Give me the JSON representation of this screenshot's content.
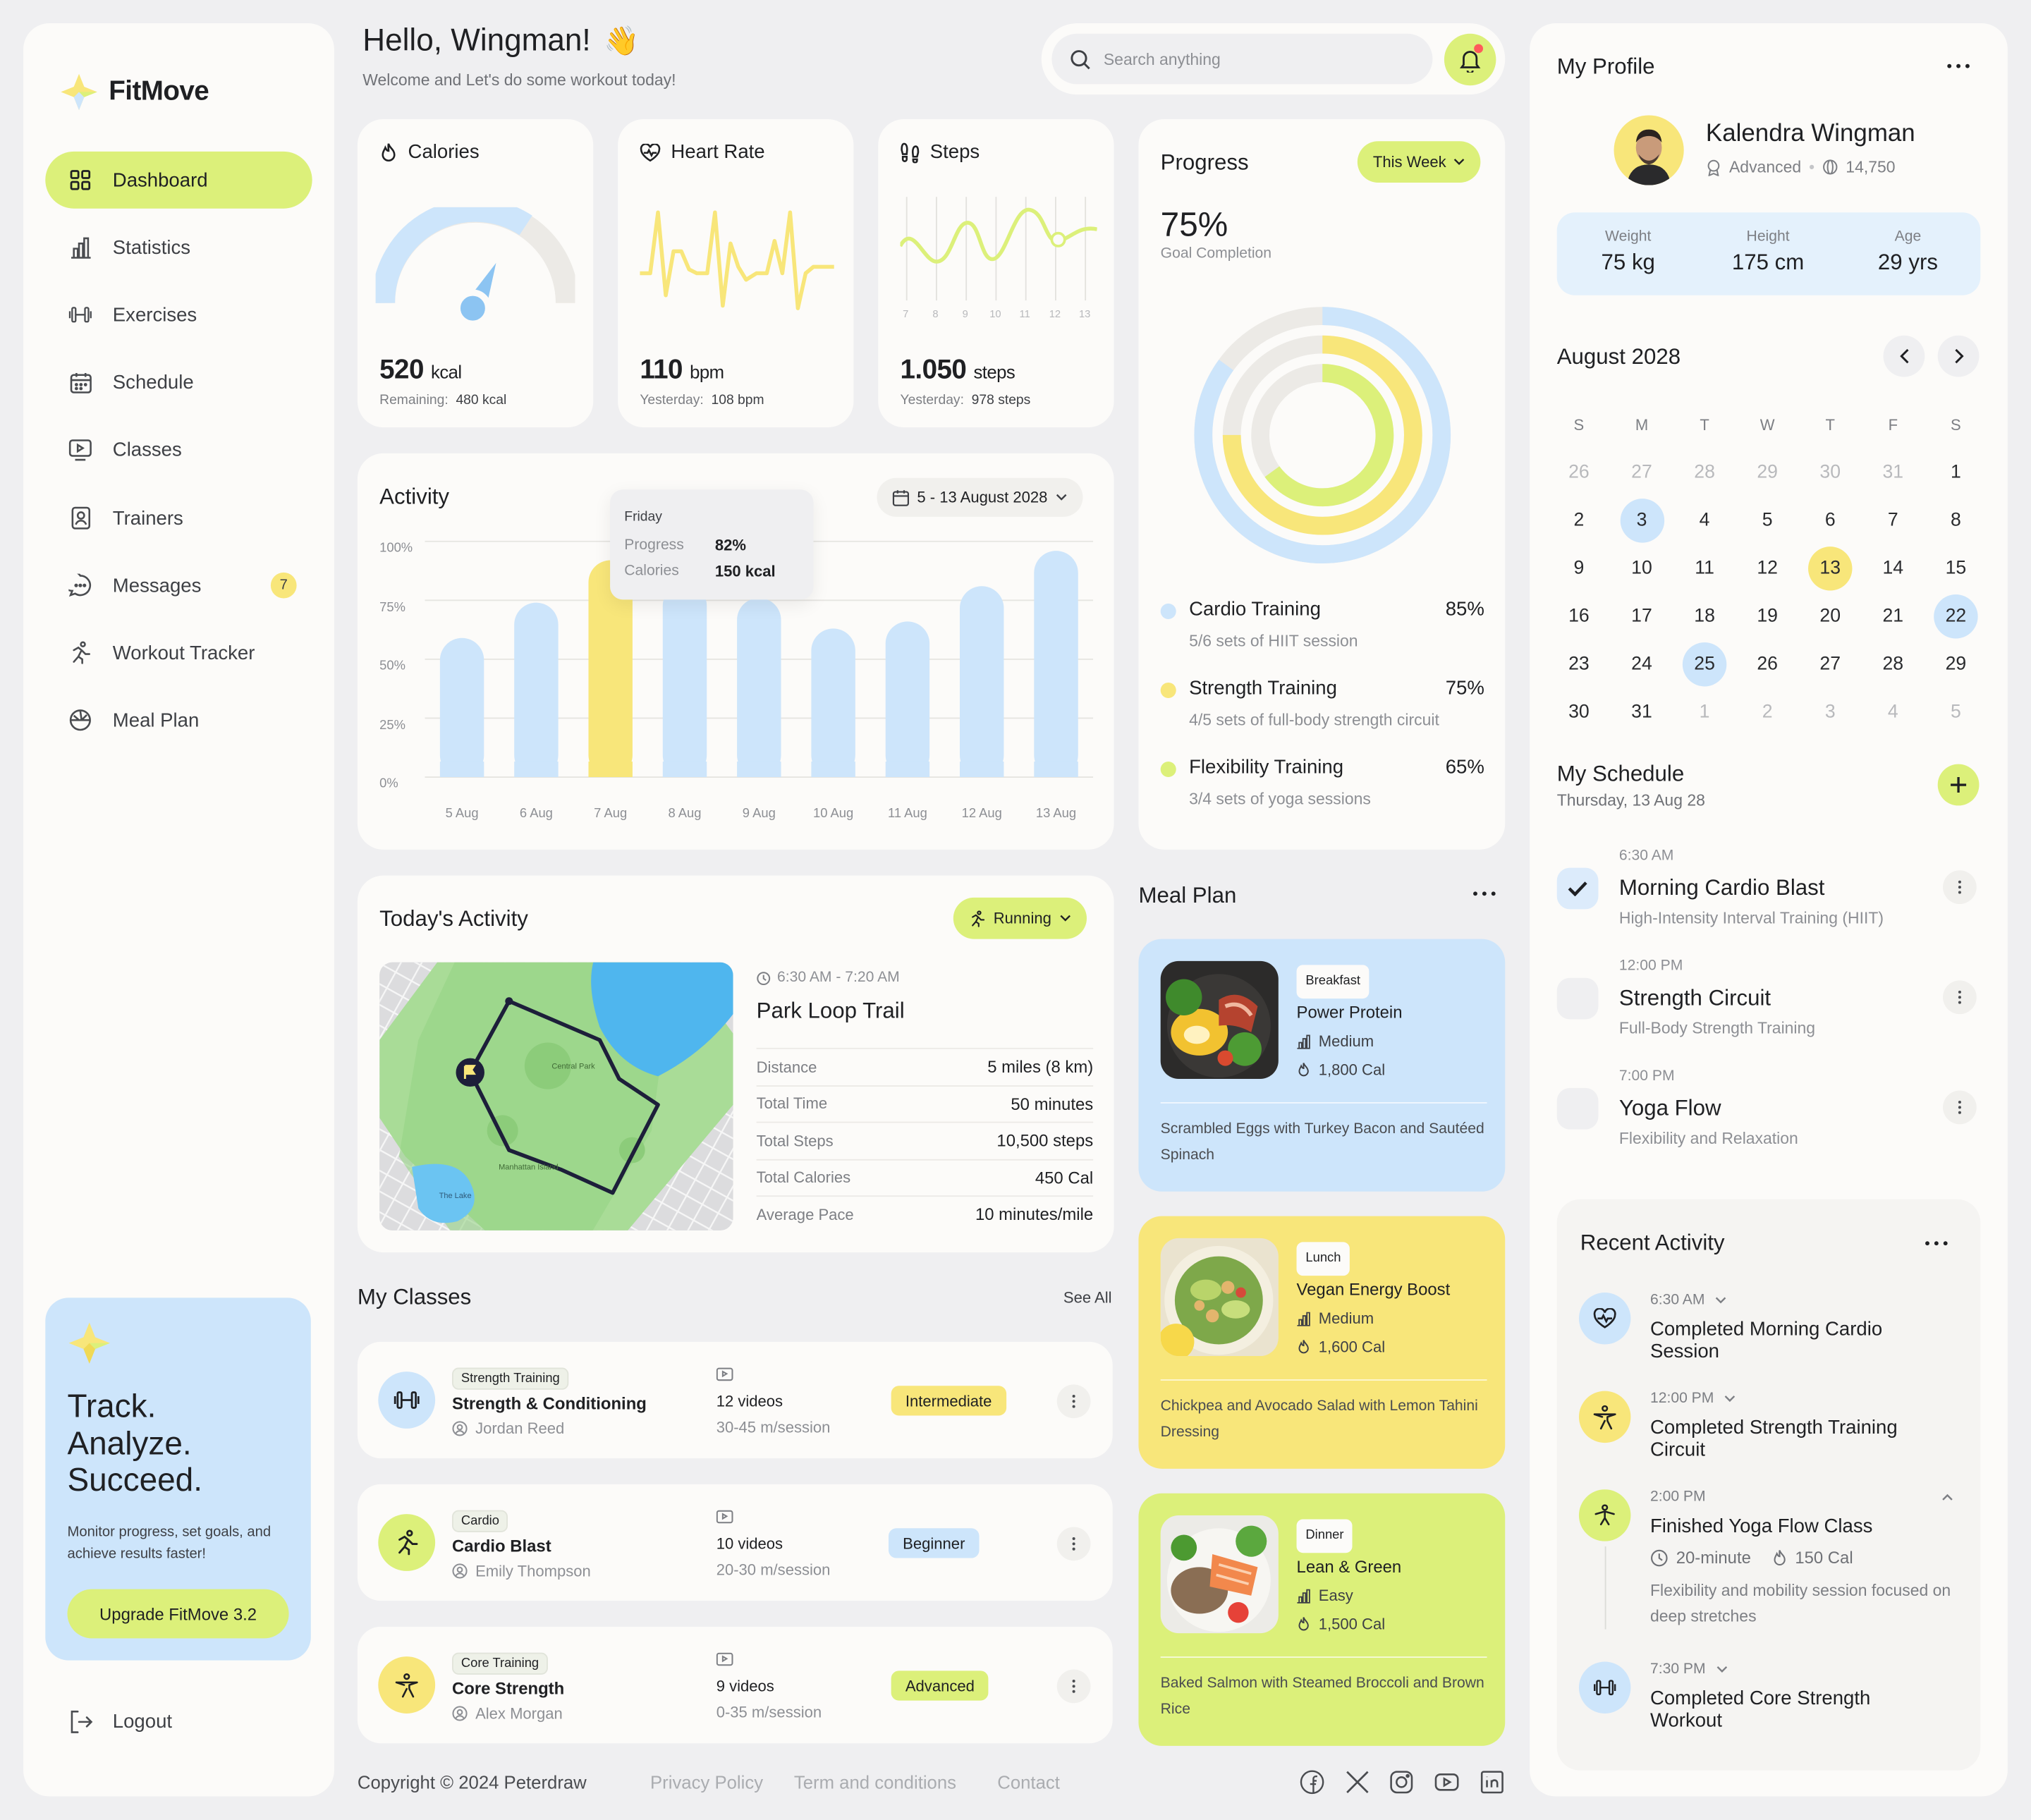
{
  "brand": {
    "name": "FitMove"
  },
  "sidebar": {
    "items": [
      {
        "label": "Dashboard"
      },
      {
        "label": "Statistics"
      },
      {
        "label": "Exercises"
      },
      {
        "label": "Schedule"
      },
      {
        "label": "Classes"
      },
      {
        "label": "Trainers"
      },
      {
        "label": "Messages",
        "badge": "7"
      },
      {
        "label": "Workout Tracker"
      },
      {
        "label": "Meal Plan"
      }
    ],
    "promo": {
      "line1": "Track.",
      "line2": "Analyze.",
      "line3": "Succeed.",
      "text": "Monitor progress, set goals, and achieve results faster!",
      "button": "Upgrade FitMove 3.2"
    },
    "logout": "Logout"
  },
  "header": {
    "greeting": "Hello, Wingman!",
    "wave": "👋",
    "subtitle": "Welcome and Let's do some workout today!",
    "search_placeholder": "Search anything"
  },
  "stats": {
    "calories": {
      "title": "Calories",
      "value": "520",
      "unit": "kcal",
      "sub_label": "Remaining:",
      "sub_value": "480 kcal",
      "fill": 0.52
    },
    "heart": {
      "title": "Heart Rate",
      "value": "110",
      "unit": "bpm",
      "sub_label": "Yesterday:",
      "sub_value": "108 bpm"
    },
    "steps": {
      "title": "Steps",
      "value": "1.050",
      "unit": "steps",
      "sub_label": "Yesterday:",
      "sub_value": "978 steps",
      "ticks": [
        "7",
        "8",
        "9",
        "10",
        "11",
        "12",
        "13"
      ]
    }
  },
  "activity": {
    "title": "Activity",
    "range": "5 - 13 August 2028",
    "tooltip": {
      "day": "Friday",
      "progress_label": "Progress",
      "progress_value": "82%",
      "calories_label": "Calories",
      "calories_value": "150 kcal"
    }
  },
  "chart_data": {
    "type": "bar",
    "categories": [
      "5 Aug",
      "6 Aug",
      "7 Aug",
      "8 Aug",
      "9 Aug",
      "10 Aug",
      "11 Aug",
      "12 Aug",
      "13 Aug"
    ],
    "values": [
      59,
      74,
      92,
      82,
      76,
      63,
      66,
      81,
      96
    ],
    "highlight_index": 2,
    "yticks": [
      "100%",
      "75%",
      "50%",
      "25%",
      "0%"
    ],
    "ylim": [
      0,
      100
    ],
    "colors": {
      "bar": "#CDE5FB",
      "highlight": "#F8E67A"
    }
  },
  "progress": {
    "title": "Progress",
    "period": "This Week",
    "percent": "75%",
    "caption": "Goal Completion",
    "items": [
      {
        "name": "Cardio Training",
        "value": "85%",
        "desc": "5/6 sets of HIIT session",
        "color": "#CDE5FB",
        "fraction": 0.85
      },
      {
        "name": "Strength Training",
        "value": "75%",
        "desc": "4/5 sets of full-body strength circuit",
        "color": "#F8E67A",
        "fraction": 0.75
      },
      {
        "name": "Flexibility Training",
        "value": "65%",
        "desc": "3/4 sets of yoga sessions",
        "color": "#DCF07A",
        "fraction": 0.65
      }
    ]
  },
  "today": {
    "title": "Today's Activity",
    "filter": "Running",
    "time": "6:30 AM - 7:20 AM",
    "route": "Park Loop Trail",
    "map_labels": [
      "Central Park",
      "Manhattan Island",
      "The Lake"
    ],
    "rows": [
      {
        "k": "Distance",
        "v": "5 miles (8 km)"
      },
      {
        "k": "Total Time",
        "v": "50 minutes"
      },
      {
        "k": "Total Steps",
        "v": "10,500 steps"
      },
      {
        "k": "Total Calories",
        "v": "450 Cal"
      },
      {
        "k": "Average Pace",
        "v": "10 minutes/mile"
      }
    ]
  },
  "classes": {
    "title": "My Classes",
    "see_all": "See All",
    "items": [
      {
        "tag": "Strength Training",
        "name": "Strength & Conditioning",
        "trainer": "Jordan Reed",
        "videos": "12 videos",
        "session": "30-45 m/session",
        "level": "Intermediate",
        "level_color": "#F8E67A"
      },
      {
        "tag": "Cardio",
        "name": "Cardio Blast",
        "trainer": "Emily Thompson",
        "videos": "10 videos",
        "session": "20-30 m/session",
        "level": "Beginner",
        "level_color": "#CDE5FB"
      },
      {
        "tag": "Core Training",
        "name": "Core Strength",
        "trainer": "Alex Morgan",
        "videos": "9 videos",
        "session": "0-35 m/session",
        "level": "Advanced",
        "level_color": "#DCF07A"
      }
    ]
  },
  "meals": {
    "title": "Meal Plan",
    "items": [
      {
        "tag": "Breakfast",
        "name": "Power Protein",
        "level": "Medium",
        "cal": "1,800 Cal",
        "desc": "Scrambled Eggs with Turkey Bacon and Sautéed Spinach",
        "color": "#CDE5FB"
      },
      {
        "tag": "Lunch",
        "name": "Vegan Energy Boost",
        "level": "Medium",
        "cal": "1,600 Cal",
        "desc": "Chickpea and Avocado Salad with Lemon Tahini Dressing",
        "color": "#F8E67A"
      },
      {
        "tag": "Dinner",
        "name": "Lean & Green",
        "level": "Easy",
        "cal": "1,500 Cal",
        "desc": "Baked Salmon with Steamed Broccoli and Brown Rice",
        "color": "#DCF07A"
      }
    ]
  },
  "profile": {
    "title": "My Profile",
    "name": "Kalendra Wingman",
    "level": "Advanced",
    "points": "14,750",
    "stats": [
      {
        "label": "Weight",
        "value": "75 kg"
      },
      {
        "label": "Height",
        "value": "175 cm"
      },
      {
        "label": "Age",
        "value": "29 yrs"
      }
    ]
  },
  "calendar": {
    "month": "August 2028",
    "weekdays": [
      "S",
      "M",
      "T",
      "W",
      "T",
      "F",
      "S"
    ],
    "days": [
      "26",
      "27",
      "28",
      "29",
      "30",
      "31",
      "1",
      "2",
      "3",
      "4",
      "5",
      "6",
      "7",
      "8",
      "9",
      "10",
      "11",
      "12",
      "13",
      "14",
      "15",
      "16",
      "17",
      "18",
      "19",
      "20",
      "21",
      "22",
      "23",
      "24",
      "25",
      "26",
      "27",
      "28",
      "29",
      "30",
      "31",
      "1",
      "2",
      "3",
      "4",
      "5"
    ]
  },
  "schedule": {
    "title": "My Schedule",
    "date": "Thursday, 13 Aug 28",
    "items": [
      {
        "time": "6:30 AM",
        "title": "Morning Cardio Blast",
        "sub": "High-Intensity Interval Training (HIIT)",
        "done": true
      },
      {
        "time": "12:00 PM",
        "title": "Strength Circuit",
        "sub": "Full-Body Strength Training",
        "done": false
      },
      {
        "time": "7:00 PM",
        "title": "Yoga Flow",
        "sub": "Flexibility and Relaxation",
        "done": false
      }
    ]
  },
  "recent": {
    "title": "Recent Activity",
    "items": [
      {
        "time": "6:30 AM",
        "title": "Completed Morning Cardio Session"
      },
      {
        "time": "12:00 PM",
        "title": "Completed Strength Training Circuit"
      },
      {
        "time": "2:00 PM",
        "title": "Finished Yoga Flow Class",
        "duration": "20-minute",
        "cal": "150 Cal",
        "desc": "Flexibility and mobility session focused on deep stretches"
      },
      {
        "time": "7:30 PM",
        "title": "Completed Core Strength Workout"
      }
    ]
  },
  "footer": {
    "copyright": "Copyright © 2024 Peterdraw",
    "links": [
      "Privacy Policy",
      "Term and conditions",
      "Contact"
    ]
  }
}
